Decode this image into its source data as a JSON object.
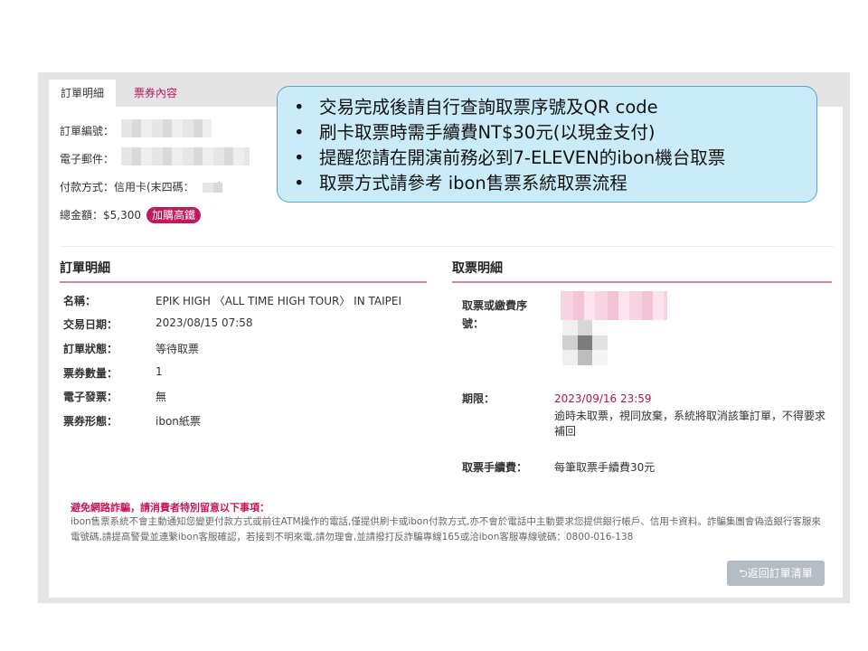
{
  "tabs": [
    {
      "label": "訂單明細",
      "active": true
    },
    {
      "label": "票券內容",
      "active": false
    }
  ],
  "order_info": {
    "order_no_label": "訂單編號：",
    "email_label": "電子郵件：",
    "payment_label": "付款方式：信用卡(末四碼：",
    "payment_suffix": ")",
    "total_label": "總金額：$5,300",
    "buy_rail_badge": "加購高鐵"
  },
  "order_detail": {
    "title": "訂單明細",
    "rows": [
      {
        "label": "名稱：",
        "value": "EPIK HIGH 〈ALL TIME HIGH TOUR〉 IN TAIPEI"
      },
      {
        "label": "交易日期：",
        "value": "2023/08/15  07:58"
      },
      {
        "label": "訂單狀態：",
        "value": "等待取票"
      },
      {
        "label": "票券數量：",
        "value": "1"
      },
      {
        "label": "電子發票：",
        "value": "無"
      },
      {
        "label": "票券形態：",
        "value": "ibon紙票"
      }
    ]
  },
  "pickup_detail": {
    "title": "取票明細",
    "code_label": "取票或繳費序號：",
    "deadline_label": "期限：",
    "deadline_value": "2023/09/16  23:59",
    "deadline_note": "逾時未取票，視同放棄，系統將取消該筆訂單，不得要求補回",
    "fee_label": "取票手續費：",
    "fee_value": "每筆取票手續費30元"
  },
  "warning": {
    "title": "避免網路詐騙，請消費者特別留意以下事項：",
    "text": "ibon售票系統不會主動通知您變更付款方式或前往ATM操作的電話,僅提供刷卡或ibon付款方式,亦不會於電話中主動要求您提供銀行帳戶、信用卡資料。詐騙集團會偽造銀行客服來電號碼,請提高警覺並連繫ibon客服確認，若接到不明來電,請勿理會,並請撥打反詐騙專線165或洽ibon客服專線號碼：0800-016-138"
  },
  "back_button": {
    "icon": "undo-icon",
    "label": "返回訂單清單"
  },
  "callout": {
    "items": [
      "交易完成後請自行查詢取票序號及QR code",
      "刷卡取票時需手續費NT$30元(以現金支付)",
      "提醒您請在開演前務必到7-ELEVEN的ibon機台取票",
      "取票方式請參考 ibon售票系統取票流程"
    ]
  },
  "colors": {
    "accent": "#c2185b",
    "deadline": "#b0154b",
    "callout_bg": "#c9ecf8",
    "button": "#b5bcc3"
  }
}
